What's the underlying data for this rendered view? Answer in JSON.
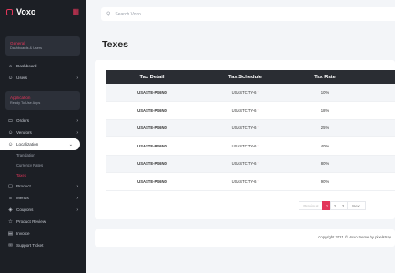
{
  "brand": {
    "name": "Voxo",
    "logo_icon": "square-logo-icon",
    "menu_icon": "grid-icon"
  },
  "sidebar": {
    "section_general": {
      "title": "General",
      "subtitle": "Dashboards & Users"
    },
    "general_items": [
      {
        "label": "Dashboard",
        "icon": "home-icon",
        "glyph": "⌂",
        "chevron": ""
      },
      {
        "label": "Users",
        "icon": "users-icon",
        "glyph": "☺",
        "chevron": "›"
      }
    ],
    "section_application": {
      "title": "Application",
      "subtitle": "Ready To Use Apps"
    },
    "app_items": [
      {
        "label": "Orders",
        "icon": "clipboard-icon",
        "glyph": "▭",
        "chevron": "›"
      },
      {
        "label": "Vendors",
        "icon": "vendor-icon",
        "glyph": "☺",
        "chevron": "›"
      }
    ],
    "localization": {
      "label": "Localization",
      "icon": "localization-icon",
      "glyph": "☺",
      "chevron": "⌄"
    },
    "sub_items": [
      {
        "label": "Translation"
      },
      {
        "label": "Currency Rates"
      },
      {
        "label": "Taxes"
      }
    ],
    "more_items": [
      {
        "label": "Product",
        "icon": "box-icon",
        "glyph": "▢",
        "chevron": "›"
      },
      {
        "label": "Menus",
        "icon": "menu-icon",
        "glyph": "≡",
        "chevron": "›"
      },
      {
        "label": "Coupons",
        "icon": "coupon-icon",
        "glyph": "◈",
        "chevron": "›"
      },
      {
        "label": "Product Review",
        "icon": "star-icon",
        "glyph": "☆",
        "chevron": ""
      },
      {
        "label": "Invoice",
        "icon": "invoice-icon",
        "glyph": "▤",
        "chevron": ""
      },
      {
        "label": "Support Ticket",
        "icon": "ticket-icon",
        "glyph": "✉",
        "chevron": ""
      }
    ]
  },
  "search": {
    "placeholder": "Search Voxo ...",
    "icon": "search-icon"
  },
  "page": {
    "title": "Texes"
  },
  "table": {
    "headers": [
      "Tax Detail",
      "Tax Schedule",
      "Tax Rate"
    ],
    "rows": [
      {
        "detail": "USASTE-PS6N0",
        "schedule": "USASTCITY-6",
        "mark": "*",
        "rate": "10%"
      },
      {
        "detail": "USASTE-PS6N0",
        "schedule": "USASTCITY-6",
        "mark": "*",
        "rate": "18%"
      },
      {
        "detail": "USASTE-PS6N0",
        "schedule": "USASTCITY-6",
        "mark": "*",
        "rate": "25%"
      },
      {
        "detail": "USASTE-PS6N0",
        "schedule": "USASTCITY-6",
        "mark": "*",
        "rate": "40%"
      },
      {
        "detail": "USASTE-PS6N0",
        "schedule": "USASTCITY-6",
        "mark": "*",
        "rate": "80%"
      },
      {
        "detail": "USASTE-PS6N0",
        "schedule": "USASTCITY-6",
        "mark": "*",
        "rate": "90%"
      }
    ]
  },
  "pagination": {
    "previous": "Previous",
    "pages": [
      "1",
      "2",
      "3"
    ],
    "next": "Next",
    "current": "1"
  },
  "footer": {
    "text": "Copyright 2021 © Voxo theme by pixelstrap"
  },
  "colors": {
    "accent": "#e2365a",
    "sidebar_bg": "#1c1f25",
    "header_bg": "#2a2d33"
  }
}
